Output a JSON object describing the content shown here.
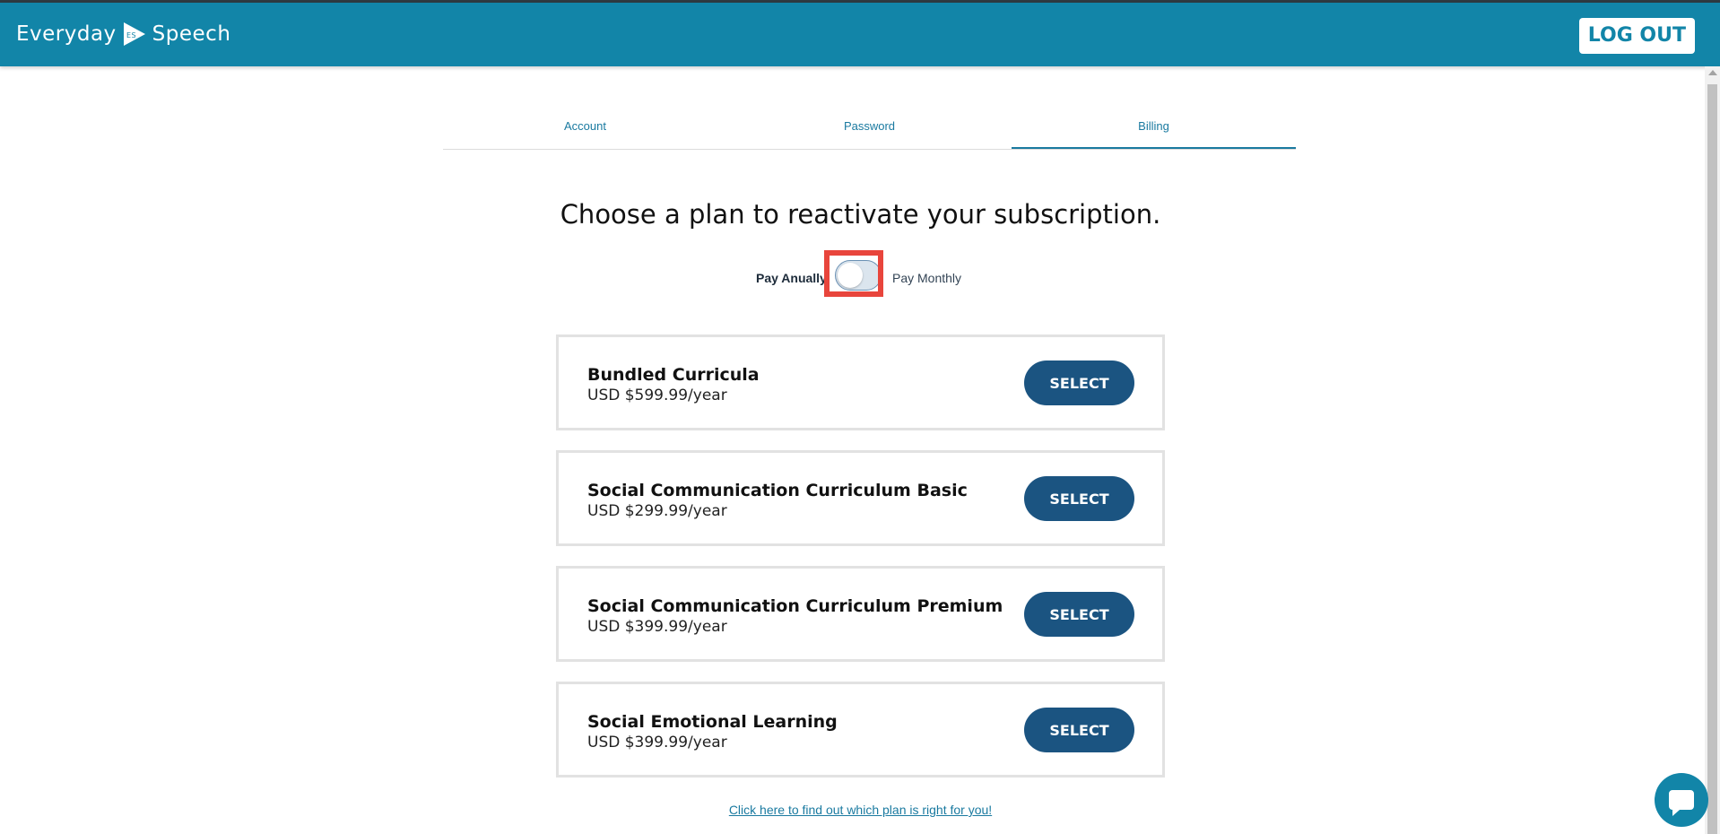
{
  "header": {
    "logo_text_left": "Everyday",
    "logo_text_right": "Speech",
    "logout_label": "LOG OUT"
  },
  "tabs": [
    {
      "label": "Account",
      "active": false
    },
    {
      "label": "Password",
      "active": false
    },
    {
      "label": "Billing",
      "active": true
    }
  ],
  "main": {
    "heading": "Choose a plan to reactivate your subscription.",
    "toggle": {
      "left_label": "Pay Anually",
      "right_label": "Pay Monthly",
      "monthly_selected": false
    },
    "plans": [
      {
        "name": "Bundled Curricula",
        "price": "USD $599.99/year",
        "button": "SELECT"
      },
      {
        "name": "Social Communication Curriculum Basic",
        "price": "USD $299.99/year",
        "button": "SELECT"
      },
      {
        "name": "Social Communication Curriculum Premium",
        "price": "USD $399.99/year",
        "button": "SELECT"
      },
      {
        "name": "Social Emotional Learning",
        "price": "USD $399.99/year",
        "button": "SELECT"
      }
    ],
    "help_link": "Click here to find out which plan is right for you!"
  },
  "icons": {
    "logo": "play-triangle-logo-icon",
    "chat": "chat-bubble-icon"
  },
  "colors": {
    "header": "#1285a8",
    "accent": "#1a7aa0",
    "button": "#1b5481",
    "highlight": "#e8453c"
  }
}
